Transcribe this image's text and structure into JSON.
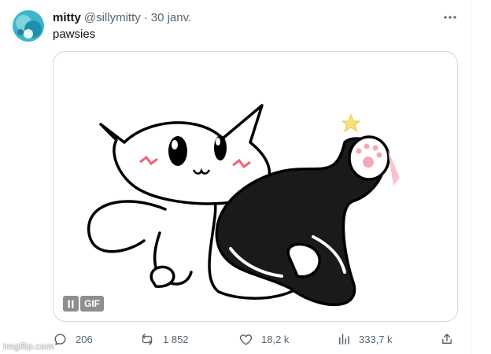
{
  "tweet": {
    "display_name": "mitty",
    "handle": "@sillymitty",
    "separator": "·",
    "date": "30 janv.",
    "text": "pawsies"
  },
  "media": {
    "pause_icon": "pause-icon",
    "gif_label": "GIF"
  },
  "actions": {
    "replies": "206",
    "reposts": "1 852",
    "likes": "18,2 k",
    "views": "333,7 k"
  },
  "watermark": "imgflip.com",
  "colors": {
    "text": "#0f1419",
    "secondary": "#536471",
    "border": "#cfd9de"
  }
}
